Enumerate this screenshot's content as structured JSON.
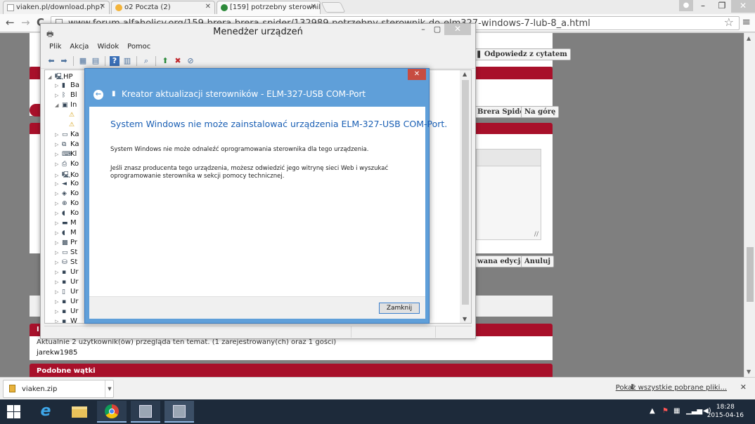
{
  "browser": {
    "tabs": [
      {
        "label": "viaken.pl/download.php?",
        "icon": "page-icon",
        "active": false
      },
      {
        "label": "o2 Poczta (2)",
        "icon": "o2-icon",
        "active": false
      },
      {
        "label": "[159] potrzebny sterownik",
        "icon": "forum-icon",
        "active": true
      }
    ],
    "url": "www.forum.alfaholicy.org/159-brera-brera-spider/132989-potrzebny-sterownik-do-elm327-windows-7-lub-8_a.html",
    "window_controls": {
      "minimize": "–",
      "restore": "❐",
      "close": "✕"
    },
    "profile_icon": "person-icon",
    "back_icon": "←",
    "forward_icon": "→",
    "reload_icon": "C",
    "star_icon": "☆",
    "menu_icon": "≡"
  },
  "forum": {
    "reply_quote_button": "Odpowiedz z cytatem",
    "brera_spider_button": "Brera Spider",
    "to_top_button": "Na górę",
    "advanced_edit_button": "wana edycja",
    "cancel_button": "Anuluj",
    "viewing_text": "Aktualnie 2 użytkownik(ów) przegląda ten temat. (1 zarejestrowany(ch) oraz 1 gości)",
    "viewer_name": "jarekw1985",
    "red_bar_letter": "I",
    "similar_threads": "Podobne wątki"
  },
  "device_manager": {
    "title": "Menedżer urządzeń",
    "menu": [
      "Plik",
      "Akcja",
      "Widok",
      "Pomoc"
    ],
    "toolbar_icons": [
      "back-icon",
      "forward-icon",
      "properties-icon",
      "show-hidden-icon",
      "help-icon",
      "view-icon",
      "scan-icon",
      "update-driver-icon",
      "uninstall-icon",
      "disable-icon"
    ],
    "tree": [
      {
        "label": "HP",
        "level": 0,
        "arrow": "◢",
        "icon": "computer-icon"
      },
      {
        "label": "Ba",
        "level": 1,
        "arrow": "▷",
        "icon": "battery-icon"
      },
      {
        "label": "Bl",
        "level": 1,
        "arrow": "▷",
        "icon": "bluetooth-icon"
      },
      {
        "label": "In",
        "level": 1,
        "arrow": "◢",
        "icon": "other-devices-icon"
      },
      {
        "label": "",
        "level": 2,
        "arrow": "",
        "icon": "warning-device-icon"
      },
      {
        "label": "",
        "level": 2,
        "arrow": "",
        "icon": "warning-device-icon"
      },
      {
        "label": "Ka",
        "level": 1,
        "arrow": "▷",
        "icon": "display-icon"
      },
      {
        "label": "Ka",
        "level": 1,
        "arrow": "▷",
        "icon": "network-icon"
      },
      {
        "label": "Kl",
        "level": 1,
        "arrow": "▷",
        "icon": "keyboard-icon"
      },
      {
        "label": "Ko",
        "level": 1,
        "arrow": "▷",
        "icon": "printer-icon"
      },
      {
        "label": "Ko",
        "level": 1,
        "arrow": "▷",
        "icon": "computer-icon"
      },
      {
        "label": "Ko",
        "level": 1,
        "arrow": "▷",
        "icon": "audio-icon"
      },
      {
        "label": "Ko",
        "level": 1,
        "arrow": "▷",
        "icon": "controller-icon"
      },
      {
        "label": "Ko",
        "level": 1,
        "arrow": "▷",
        "icon": "hub-icon"
      },
      {
        "label": "Ko",
        "level": 1,
        "arrow": "▷",
        "icon": "mouse-icon"
      },
      {
        "label": "M",
        "level": 1,
        "arrow": "▷",
        "icon": "monitor-icon"
      },
      {
        "label": "M",
        "level": 1,
        "arrow": "▷",
        "icon": "mouse-icon"
      },
      {
        "label": "Pr",
        "level": 1,
        "arrow": "▷",
        "icon": "processor-icon"
      },
      {
        "label": "St",
        "level": 1,
        "arrow": "▷",
        "icon": "disk-icon"
      },
      {
        "label": "St",
        "level": 1,
        "arrow": "▷",
        "icon": "storage-icon"
      },
      {
        "label": "Ur",
        "level": 1,
        "arrow": "▷",
        "icon": "device-icon"
      },
      {
        "label": "Ur",
        "level": 1,
        "arrow": "▷",
        "icon": "device-icon"
      },
      {
        "label": "Ur",
        "level": 1,
        "arrow": "▷",
        "icon": "phone-icon"
      },
      {
        "label": "Ur",
        "level": 1,
        "arrow": "▷",
        "icon": "device-icon"
      },
      {
        "label": "Ur",
        "level": 1,
        "arrow": "▷",
        "icon": "device-icon"
      },
      {
        "label": "W",
        "level": 1,
        "arrow": "▷",
        "icon": "device-icon"
      }
    ]
  },
  "wizard": {
    "title": "Kreator aktualizacji sterowników - ELM-327-USB COM-Port",
    "heading": "System Windows nie może zainstalować urządzenia ELM-327-USB COM-Port.",
    "paragraph1": "System Windows nie może odnaleźć oprogramowania sterownika dla tego urządzenia.",
    "paragraph2_line1": "Jeśli znasz producenta tego urządzenia, możesz odwiedzić jego witrynę sieci Web i wyszukać",
    "paragraph2_line2": "oprogramowanie sterownika w sekcji pomocy technicznej.",
    "close_button": "Zamknij",
    "close_icon": "✕",
    "back_icon": "←"
  },
  "download_bar": {
    "file_name": "viaken.zip",
    "show_all": "Pokaż wszystkie pobrane pliki...",
    "close_icon": "✕"
  },
  "taskbar": {
    "apps": [
      "ie-icon",
      "explorer-icon",
      "chrome-icon",
      "devmgr-icon",
      "devmgr-icon"
    ],
    "time": "18:28",
    "date": "2015-04-16",
    "tray_icons": [
      "show-hidden-icon",
      "flag-icon",
      "network-icon",
      "signal-icon",
      "volume-icon"
    ]
  },
  "colors": {
    "forum_red": "#a8102a",
    "wizard_blue": "#5f9fd9",
    "heading_blue": "#1a5fb4",
    "taskbar": "#1d2a3a"
  }
}
